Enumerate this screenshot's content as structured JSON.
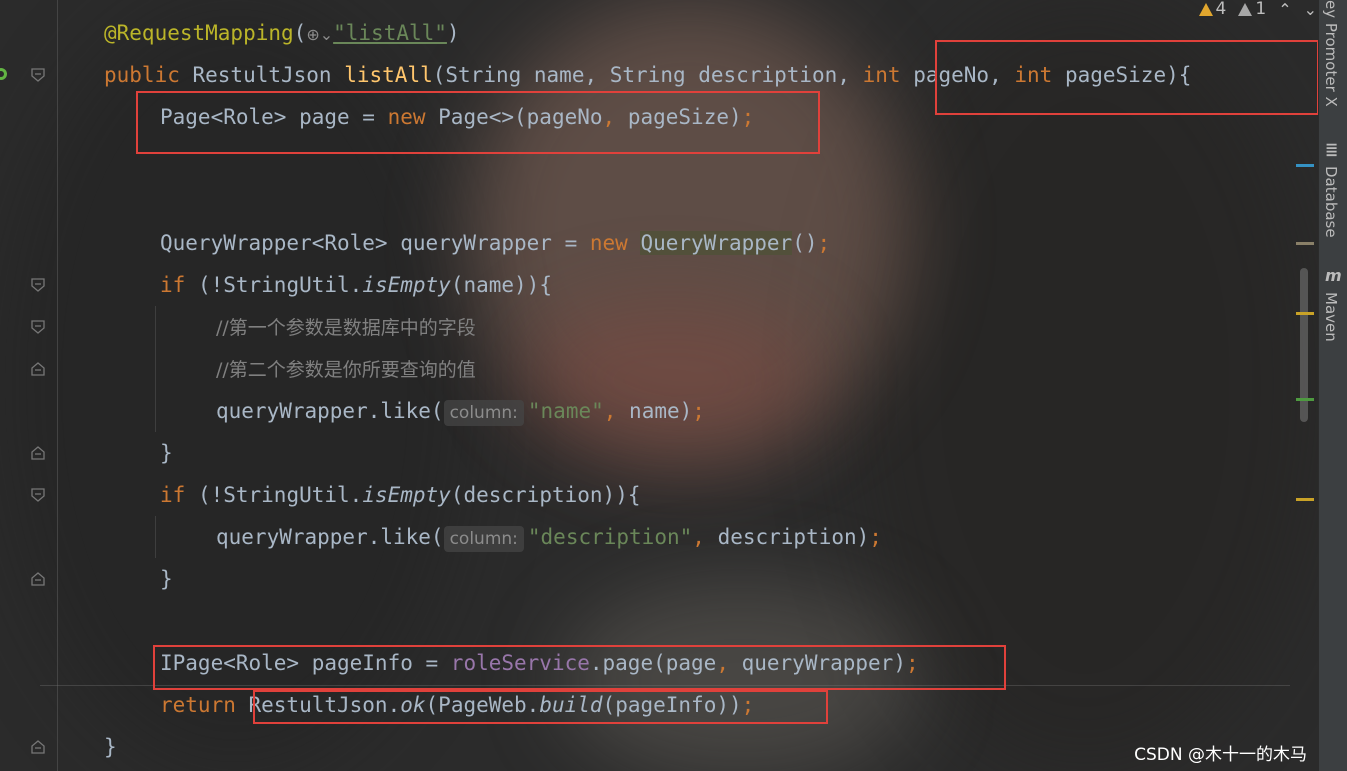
{
  "editor": {
    "lines": {
      "l1": {
        "annotation": "@RequestMapping",
        "open": "(",
        "string": "\"listAll\"",
        "close": ")"
      },
      "l2": {
        "kw1": "public",
        "type": " RestultJson ",
        "method": "listAll",
        "p1": "(String name, String description, ",
        "kw2": "int",
        "p2": " pageNo, ",
        "kw3": "int",
        "p3": " pageSize",
        "end": "){"
      },
      "l3": {
        "t1": "Page<Role> page = ",
        "kw": "new",
        "t2": " Page<>(pageNo",
        "comma": ",",
        "t3": " pageSize)",
        "semi": ";"
      },
      "l6": {
        "t1": "QueryWrapper<Role> queryWrapper = ",
        "kw": "new",
        "sp": " ",
        "hl": "QueryWrapper",
        "t2": "()",
        "semi": ";"
      },
      "l7": {
        "kw": "if",
        "t1": " (!StringUtil.",
        "it": "isEmpty",
        "t2": "(name)){"
      },
      "l8": {
        "comment": "//第一个参数是数据库中的字段"
      },
      "l9": {
        "comment": "//第二个参数是你所要查询的值"
      },
      "l10": {
        "t1": "queryWrapper.like(",
        "hint": "column:",
        "str": "\"name\"",
        "comma": ",",
        "t2": " name)",
        "semi": ";"
      },
      "l11": {
        "t1": "}"
      },
      "l12": {
        "kw": "if",
        "t1": " (!StringUtil.",
        "it": "isEmpty",
        "t2": "(description)){"
      },
      "l13": {
        "t1": "queryWrapper.like(",
        "hint": "column:",
        "str": "\"description\"",
        "comma": ",",
        "t2": " description)",
        "semi": ";"
      },
      "l14": {
        "t1": "}"
      },
      "l16": {
        "t1": "IPage<Role> pageInfo = ",
        "fld": "roleService",
        "t2": ".page(page",
        "comma": ",",
        "t3": " queryWrapper)",
        "semi": ";"
      },
      "l17": {
        "kw": "return",
        "t1": " RestultJson.",
        "it1": "ok",
        "t2": "(PageWeb.",
        "it2": "build",
        "t3": "(pageInfo))",
        "semi": ";"
      },
      "l18": {
        "t1": "}"
      }
    }
  },
  "inspections": {
    "warnings": "4",
    "weak_warnings": "1",
    "up_icon": "chevron-up-icon",
    "down_icon": "chevron-down-icon"
  },
  "sidebar": {
    "tab1": "ey Promoter X",
    "tab2": "Database",
    "tab3": "Maven"
  },
  "watermark": "CSDN @木十一的木马",
  "colors": {
    "keyword": "#cc7832",
    "annotation": "#bbb529",
    "string": "#6a8759",
    "method": "#ffc66d",
    "field": "#9876aa",
    "highlight_box": "#e0413b"
  }
}
